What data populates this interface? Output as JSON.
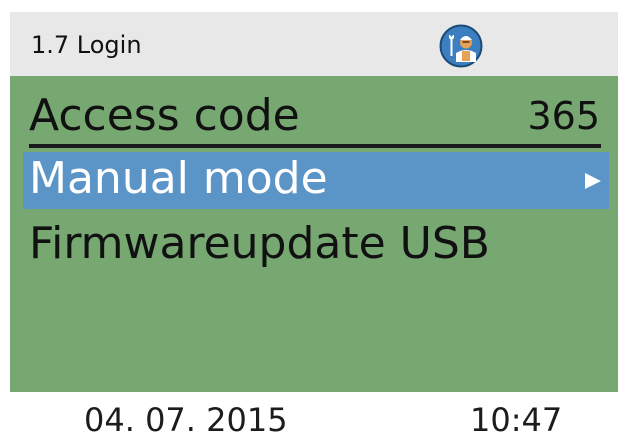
{
  "header": {
    "title": "1.7 Login",
    "icon": "service-technician-icon"
  },
  "menu": {
    "items": [
      {
        "label": "Access code",
        "value": "365",
        "selected": false
      },
      {
        "label": "Manual mode",
        "value": "",
        "selected": true,
        "arrow": "arrow-right-icon"
      },
      {
        "label": "Firmwareupdate USB",
        "value": "",
        "selected": false
      }
    ]
  },
  "footer": {
    "date": "04. 07. 2015",
    "time": "10:47"
  },
  "colors": {
    "screen_background": "#77a872",
    "header_background": "#e8e8e8",
    "selection": "#5b95c7",
    "icon_circle": "#3c7fc0",
    "icon_face": "#e7a25a"
  }
}
